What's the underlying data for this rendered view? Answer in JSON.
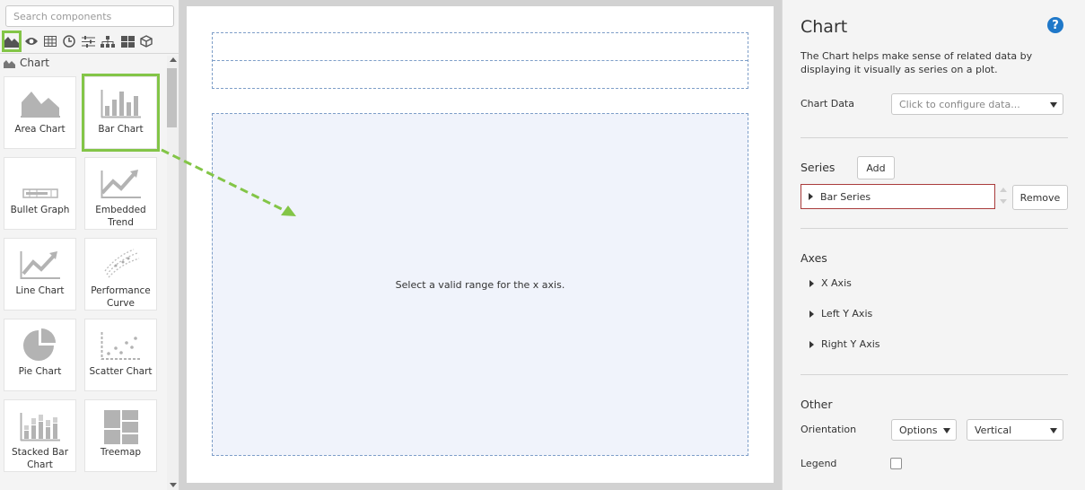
{
  "palette": {
    "search_placeholder": "Search components",
    "categories": [
      "chart-icon",
      "eye-icon",
      "grid-icon",
      "clock-icon",
      "sliders-icon",
      "hierarchy-icon",
      "tiles-icon",
      "cube-icon"
    ],
    "section_label": "Chart",
    "tiles": [
      {
        "label": "Area Chart",
        "icon": "area-chart-icon"
      },
      {
        "label": "Bar Chart",
        "icon": "bar-chart-icon",
        "selected": true
      },
      {
        "label": "Bullet Graph",
        "icon": "bullet-graph-icon"
      },
      {
        "label": "Embedded Trend",
        "icon": "embedded-trend-icon"
      },
      {
        "label": "Line Chart",
        "icon": "line-chart-icon"
      },
      {
        "label": "Performance Curve",
        "icon": "performance-curve-icon"
      },
      {
        "label": "Pie Chart",
        "icon": "pie-chart-icon"
      },
      {
        "label": "Scatter Chart",
        "icon": "scatter-chart-icon"
      },
      {
        "label": "Stacked Bar Chart",
        "icon": "stacked-bar-chart-icon"
      },
      {
        "label": "Treemap",
        "icon": "treemap-icon"
      }
    ]
  },
  "canvas": {
    "message": "Select a valid range for the x axis."
  },
  "properties": {
    "title": "Chart",
    "description": "The Chart helps make sense of related data by displaying it visually as series on a plot.",
    "chart_data_label": "Chart Data",
    "chart_data_placeholder": "Click to configure data...",
    "series_title": "Series",
    "add_label": "Add",
    "series_item": "Bar Series",
    "remove_label": "Remove",
    "axes_title": "Axes",
    "axes": [
      "X Axis",
      "Left Y Axis",
      "Right Y Axis"
    ],
    "other_title": "Other",
    "orientation_label": "Orientation",
    "orientation_mode": "Options",
    "orientation_value": "Vertical",
    "legend_label": "Legend",
    "legend_checked": false
  },
  "colors": {
    "selection_green": "#83c547",
    "help_blue": "#1f78c9",
    "series_border": "#a93b3b",
    "dropzone_blue": "#7e9ec8"
  }
}
